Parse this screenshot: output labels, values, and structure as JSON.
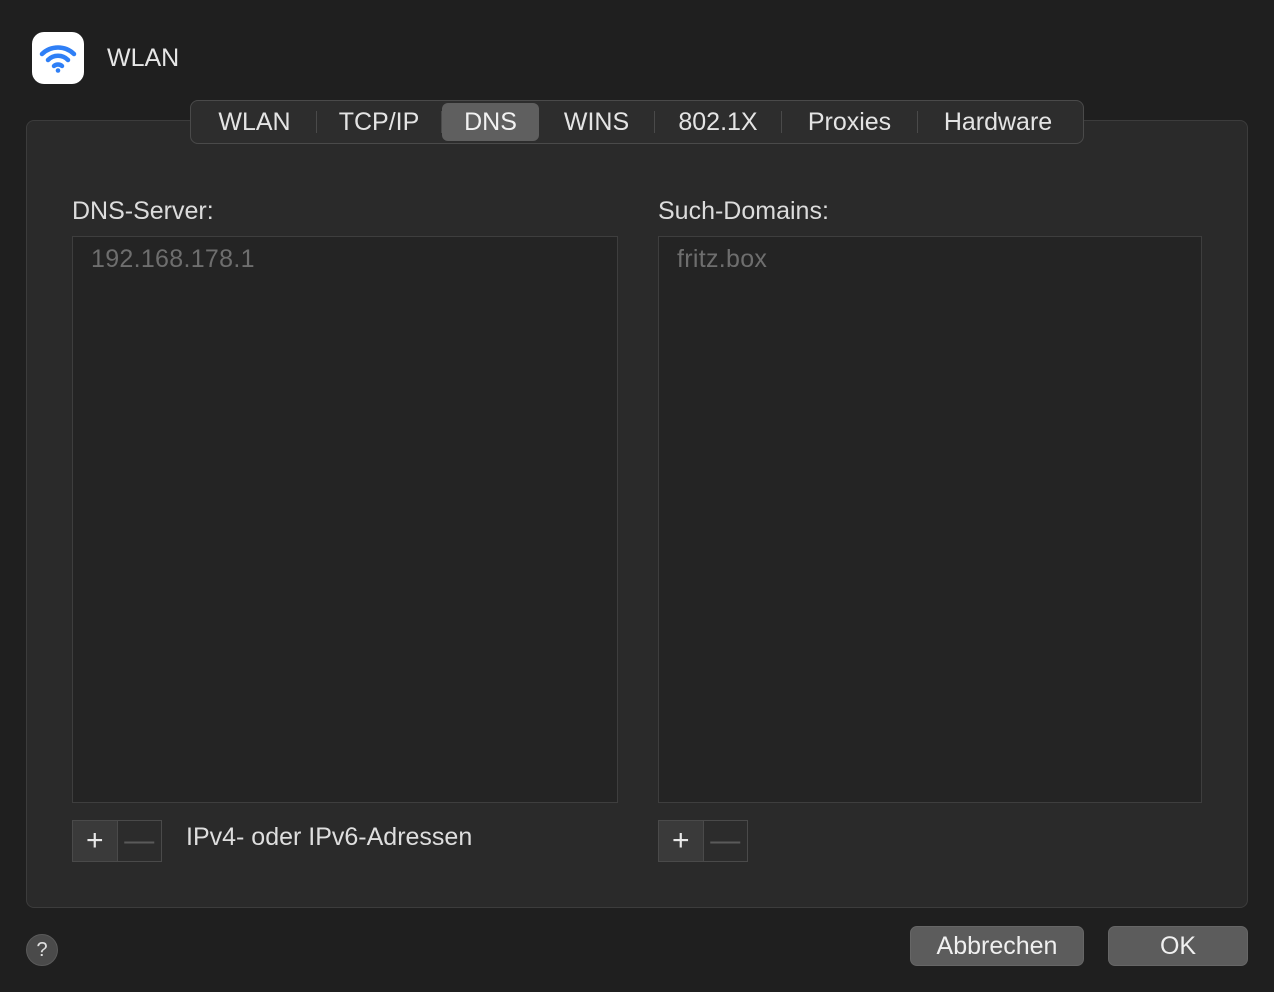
{
  "header": {
    "title": "WLAN",
    "icon": "wifi-icon",
    "icon_color": "#2f7ff6"
  },
  "tabs": [
    {
      "label": "WLAN",
      "active": false
    },
    {
      "label": "TCP/IP",
      "active": false
    },
    {
      "label": "DNS",
      "active": true
    },
    {
      "label": "WINS",
      "active": false
    },
    {
      "label": "802.1X",
      "active": false
    },
    {
      "label": "Proxies",
      "active": false
    },
    {
      "label": "Hardware",
      "active": false
    }
  ],
  "dns": {
    "label": "DNS-Server:",
    "entries": [
      "192.168.178.1"
    ],
    "hint": "IPv4- oder IPv6-Adressen",
    "add_symbol": "+",
    "remove_symbol": "—"
  },
  "search": {
    "label": "Such-Domains:",
    "entries": [
      "fritz.box"
    ],
    "add_symbol": "+",
    "remove_symbol": "—"
  },
  "footer": {
    "help_symbol": "?",
    "cancel_label": "Abbrechen",
    "ok_label": "OK"
  }
}
